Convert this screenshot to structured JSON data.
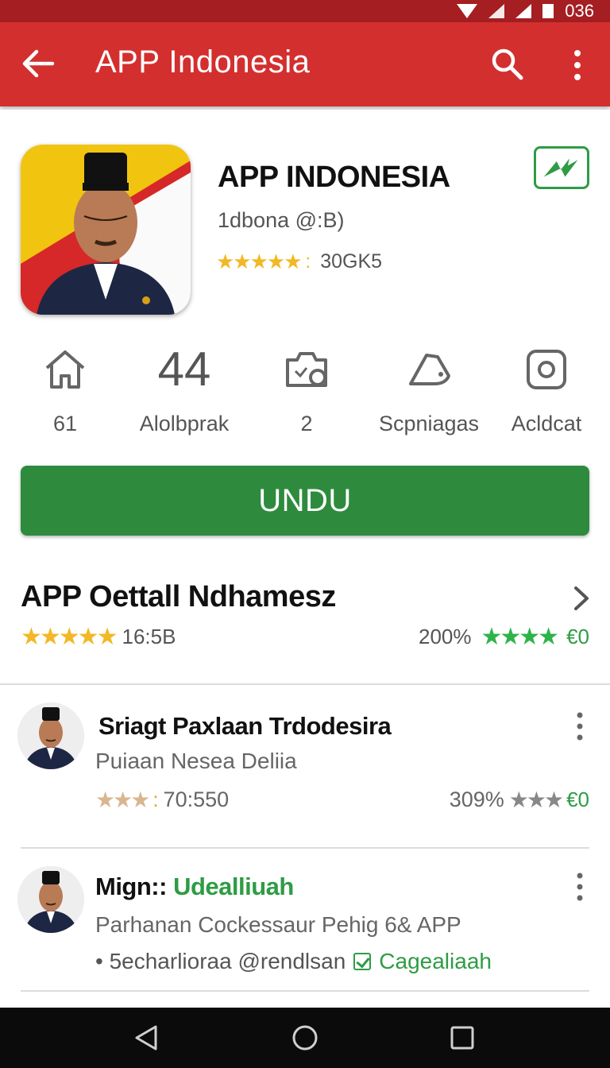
{
  "status_bar": {
    "time": "036"
  },
  "app_bar": {
    "title": "APP Indonesia"
  },
  "app": {
    "name": "APP INDONESIA",
    "developer": "1dbona @:B)",
    "rating_stars": "★★★★★",
    "rating_sep": ":",
    "rating_count": "30GK5"
  },
  "stats": [
    {
      "value": "61",
      "icon": "home-icon"
    },
    {
      "value": "44",
      "label": "Alolbprak"
    },
    {
      "value": "2",
      "icon": "camera-icon"
    },
    {
      "label": "Scpniagas",
      "icon": "tag-icon"
    },
    {
      "label": "Acldcat",
      "icon": "instagram-icon"
    }
  ],
  "install_button": "UNDU",
  "section": {
    "title": "APP Oettall Ndhamesz",
    "stars": "★★★★★",
    "rating_text": "16:5B",
    "percent": "200%",
    "right_stars": "★★★★",
    "right_value": "€0"
  },
  "reviews": [
    {
      "title": "Sriagt Paxlaan Trdodesira",
      "subtitle": "Puiaan Nesea Deliia",
      "stars": "★★★",
      "sep": ":",
      "value": "70:550",
      "percent": "309%",
      "right_stars": "★★★",
      "right_value": "€0"
    },
    {
      "title_prefix": "Mign::",
      "title_green": "Udealliuah",
      "subtitle": "Parhanan Cockessaur Pehig 6& APP",
      "meta": "• 5echarlioraa @rendlsan",
      "meta_green": "Cagealiaah"
    }
  ],
  "colors": {
    "app_bar": "#d32f2f",
    "status_bar": "#a51e22",
    "install": "#2e8b3d",
    "star_gold": "#f2b825",
    "star_green": "#2eb34a"
  }
}
